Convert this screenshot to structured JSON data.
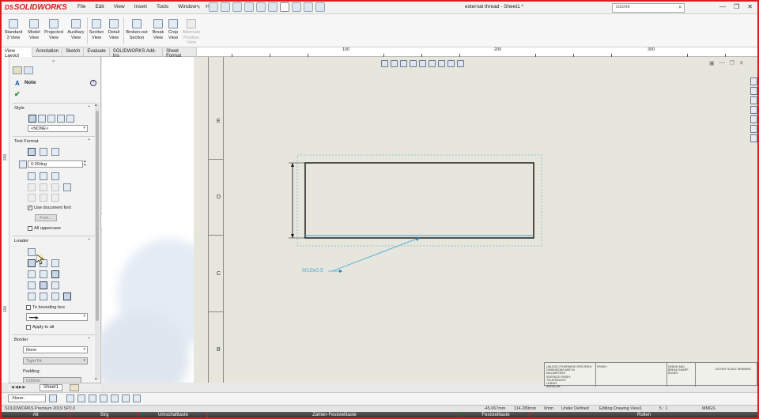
{
  "app": {
    "name": "SOLIDWORKS",
    "logo_prefix": "DS"
  },
  "menu": [
    "File",
    "Edit",
    "View",
    "Insert",
    "Tools",
    "Window",
    "Help"
  ],
  "doc_title": "external thread - Sheet1 *",
  "search": {
    "value": "cosme"
  },
  "ribbon": [
    {
      "label": "Standard\n3 View",
      "enabled": true
    },
    {
      "label": "Model\nView",
      "enabled": true
    },
    {
      "label": "Projected\nView",
      "enabled": true
    },
    {
      "label": "Auxiliary\nView",
      "enabled": true
    },
    {
      "label": "Section\nView",
      "enabled": true
    },
    {
      "label": "Detail\nView",
      "enabled": true
    },
    {
      "label": "Broken-out\nSection",
      "enabled": true
    },
    {
      "label": "Break\nView",
      "enabled": true
    },
    {
      "label": "Crop\nView",
      "enabled": true
    },
    {
      "label": "Alternate\nPosition\nView",
      "enabled": false
    }
  ],
  "tabs": [
    "View Layout",
    "Annotation",
    "Sketch",
    "Evaluate",
    "SOLIDWORKS Add-Ins",
    "Sheet Format"
  ],
  "active_tab": "View Layout",
  "top_ruler": [
    "100",
    "200",
    "300"
  ],
  "left_ruler": [
    "200",
    "100"
  ],
  "property_manager": {
    "title": "Note",
    "sections": {
      "style": "Style",
      "text_format": "Text Format",
      "leader": "Leader",
      "border": "Border"
    },
    "style_dropdown": "<NONE>",
    "angle_value": "0.00deg",
    "use_document_font": {
      "label": "Use document font",
      "checked": true
    },
    "font_button": "Font...",
    "all_uppercase": {
      "label": "All uppercase",
      "checked": false
    },
    "to_bounding_box": {
      "label": "To bounding box",
      "checked": false
    },
    "apply_to_all": {
      "label": "Apply to all",
      "checked": false
    },
    "border_dropdown": "None",
    "fit_dropdown": "Tight Fit",
    "padding_label": "Padding:",
    "padding_value": "0.00mm"
  },
  "zones": [
    "E",
    "D",
    "C",
    "B"
  ],
  "callout_text": "M10x0.5",
  "sheet_tab": "Sheet1",
  "layer_dropdown": "-None-",
  "status": {
    "product": "SOLIDWORKS Premium 2019 SP2.0",
    "x": "-45.067mm",
    "y": "114.289mm",
    "z": "0mm",
    "state": "Under Defined",
    "mode": "Editing Drawing View1",
    "scale": "5 : 1",
    "units": "MMGS"
  },
  "keys": [
    "Alt",
    "Strg",
    "Umschalttaste",
    "Zahlen-Feststelltaste",
    "Feststelltaste",
    "Rollen"
  ],
  "title_block": {
    "c1": "UNLESS OTHERWISE SPECIFIED:\nDIMENSIONS ARE IN MILLIMETERS\nSURFACE FINISH:\nTOLERANCES:\nLINEAR:\nANGULAR:",
    "c2": "FINISH:",
    "c3": "DEBUR AND\nBREAK SHARP\nEDGES",
    "c4": "DO NOT SCALE DRAWING"
  }
}
